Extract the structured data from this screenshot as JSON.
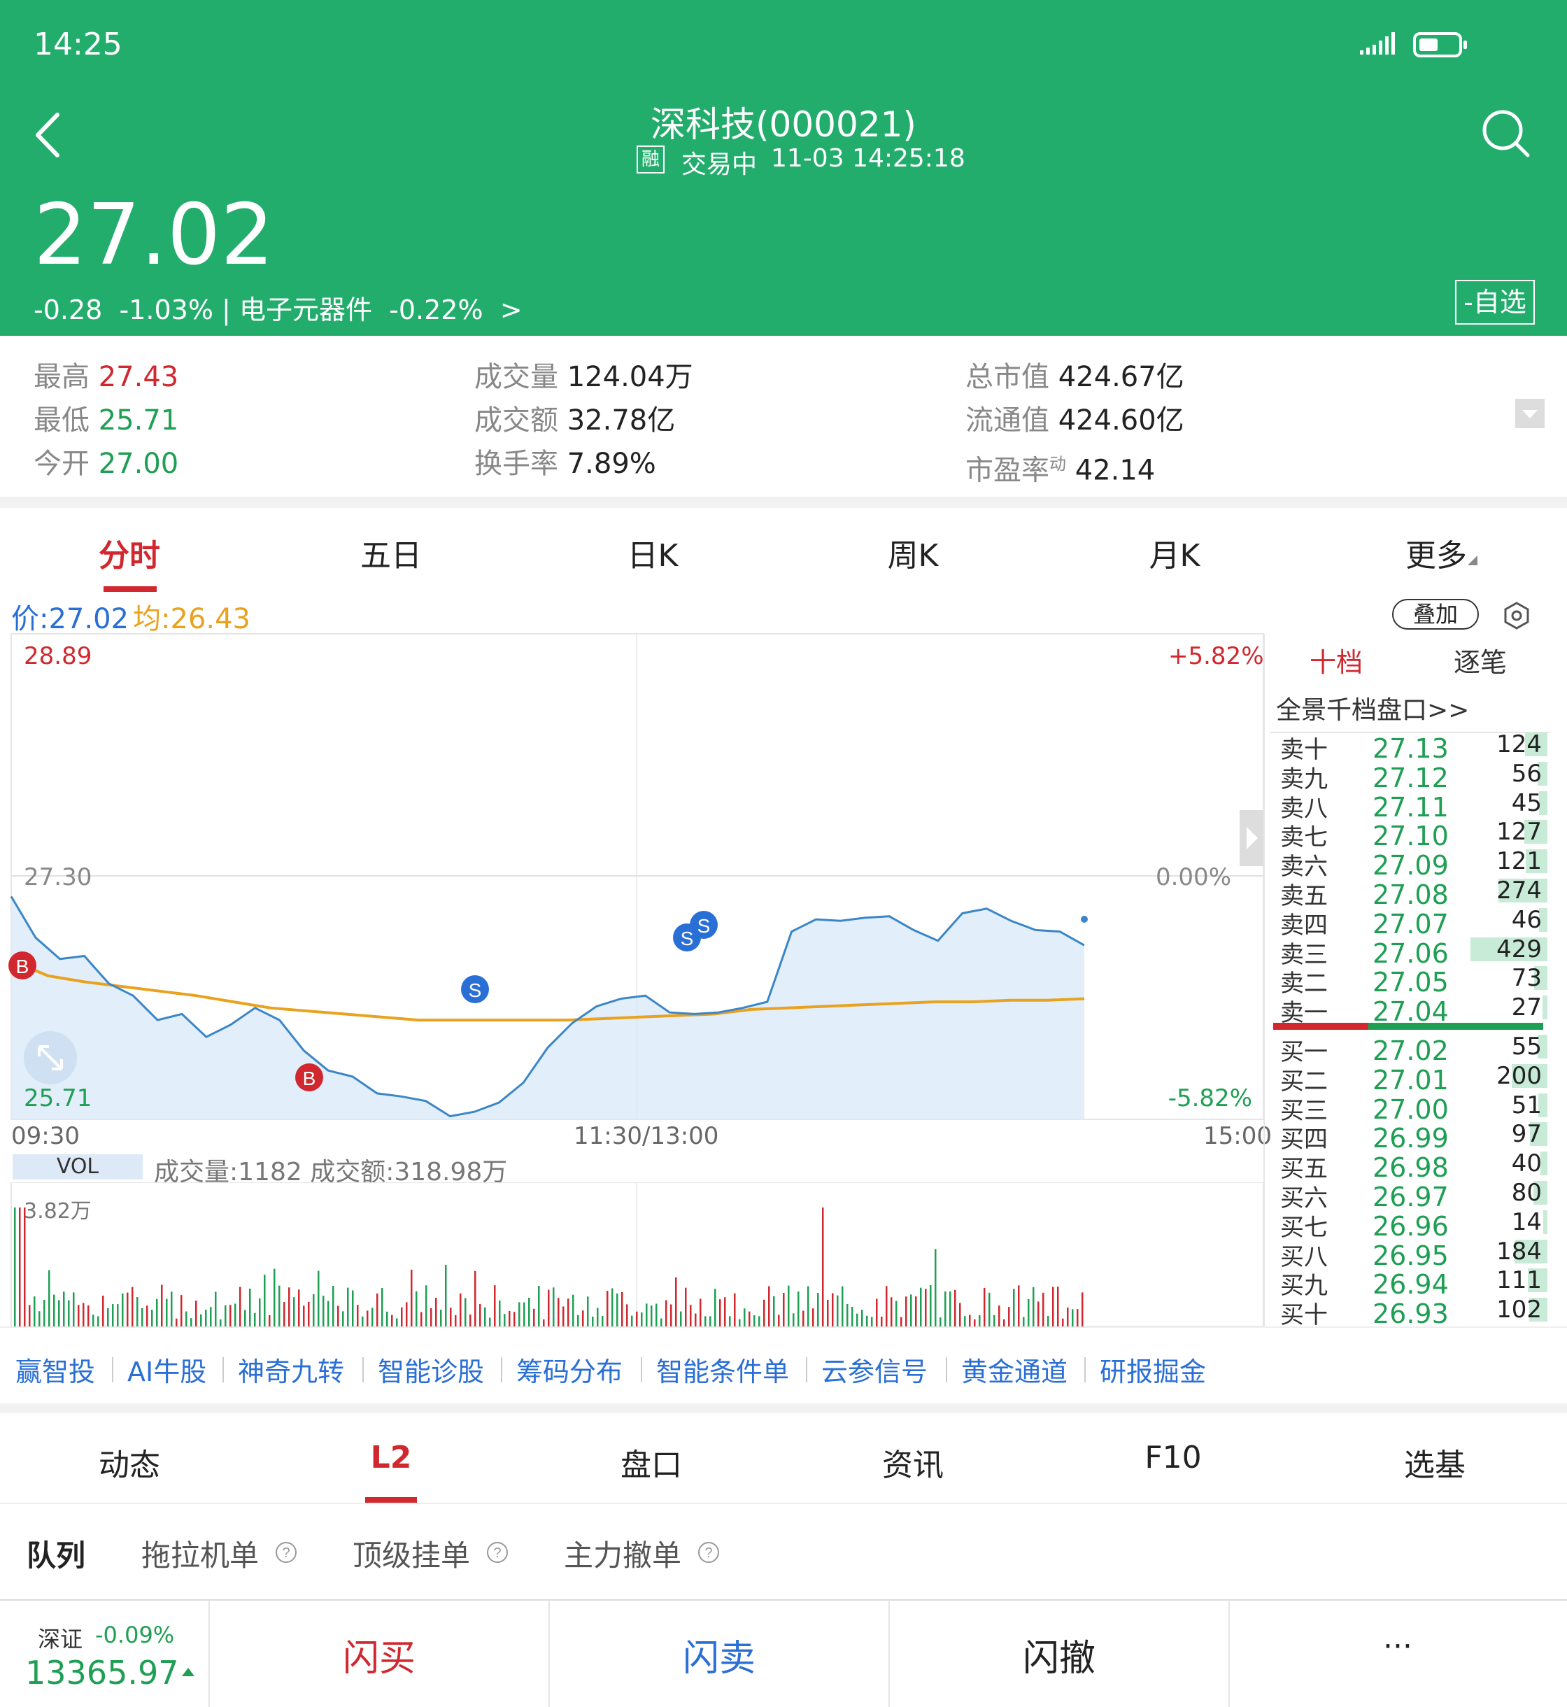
{
  "status_bar": {
    "time": "14:25"
  },
  "header": {
    "title": "深科技(000021)",
    "margin_tag": "融",
    "trade_status": "交易中",
    "datetime": "11-03 14:25:18",
    "price": "27.02",
    "change": "-0.28",
    "change_pct": "-1.03%",
    "sector_sep": "|",
    "sector": "电子元器件",
    "sector_pct": "-0.22%",
    "sector_arrow": ">",
    "watch_button": "-自选"
  },
  "stats": {
    "high_label": "最高",
    "high": "27.43",
    "low_label": "最低",
    "low": "25.71",
    "open_label": "今开",
    "open": "27.00",
    "volume_label": "成交量",
    "volume": "124.04万",
    "amount_label": "成交额",
    "amount": "32.78亿",
    "turnover_label": "换手率",
    "turnover": "7.89%",
    "mktcap_label": "总市值",
    "mktcap": "424.67亿",
    "float_label": "流通值",
    "float": "424.60亿",
    "pe_label": "市盈率",
    "pe_sup": "动",
    "pe": "42.14"
  },
  "chart_tabs": [
    "分时",
    "五日",
    "日K",
    "周K",
    "月K",
    "更多"
  ],
  "chart_header": {
    "price_label": "价:27.02",
    "avg_label": "均:26.43",
    "overlay": "叠加"
  },
  "chart_labels": {
    "ymax": "28.89",
    "ymid": "27.30",
    "ymin": "25.71",
    "pmax": "+5.82%",
    "pmid": "0.00%",
    "pmin": "-5.82%",
    "t_start": "09:30",
    "t_mid": "11:30/13:00",
    "t_end": "15:00",
    "vol_tab": "VOL",
    "vol_info": "成交量:1182 成交额:318.98万",
    "vol_max": "3.82万"
  },
  "chart_data": {
    "type": "line",
    "ylim": [
      25.71,
      28.89
    ],
    "series": [
      {
        "values": [
          27.17,
          26.9,
          26.76,
          26.78,
          26.6,
          26.52,
          26.36,
          26.4,
          26.25,
          26.33,
          26.44,
          26.36,
          26.16,
          26.03,
          25.99,
          25.88,
          25.86,
          25.83,
          25.73,
          25.76,
          25.82,
          25.95,
          26.18,
          26.34,
          26.45,
          26.5,
          26.52,
          26.41,
          26.4,
          26.41,
          26.44,
          26.48,
          26.94,
          27.02,
          27.01,
          27.03,
          27.04,
          26.95,
          26.88,
          27.06,
          27.09,
          27.01,
          26.95,
          26.94,
          26.85
        ]
      },
      {
        "values": [
          26.75,
          26.65,
          26.61,
          26.58,
          26.55,
          26.52,
          26.48,
          26.44,
          26.42,
          26.4,
          26.38,
          26.36,
          26.36,
          26.36,
          26.36,
          26.36,
          26.37,
          26.38,
          26.39,
          26.4,
          26.43,
          26.44,
          26.45,
          26.46,
          26.47,
          26.48,
          26.48,
          26.49,
          26.49,
          26.5
        ]
      }
    ]
  },
  "orderbook": {
    "tab_active": "十档",
    "tab_other": "逐笔",
    "link": "全景千档盘口>>",
    "asks": [
      {
        "label": "卖十",
        "price": "27.13",
        "vol": "124"
      },
      {
        "label": "卖九",
        "price": "27.12",
        "vol": "56"
      },
      {
        "label": "卖八",
        "price": "27.11",
        "vol": "45"
      },
      {
        "label": "卖七",
        "price": "27.10",
        "vol": "127"
      },
      {
        "label": "卖六",
        "price": "27.09",
        "vol": "121"
      },
      {
        "label": "卖五",
        "price": "27.08",
        "vol": "274"
      },
      {
        "label": "卖四",
        "price": "27.07",
        "vol": "46"
      },
      {
        "label": "卖三",
        "price": "27.06",
        "vol": "429"
      },
      {
        "label": "卖二",
        "price": "27.05",
        "vol": "73"
      },
      {
        "label": "卖一",
        "price": "27.04",
        "vol": "27"
      }
    ],
    "bids": [
      {
        "label": "买一",
        "price": "27.02",
        "vol": "55"
      },
      {
        "label": "买二",
        "price": "27.01",
        "vol": "200"
      },
      {
        "label": "买三",
        "price": "27.00",
        "vol": "51"
      },
      {
        "label": "买四",
        "price": "26.99",
        "vol": "97"
      },
      {
        "label": "买五",
        "price": "26.98",
        "vol": "40"
      },
      {
        "label": "买六",
        "price": "26.97",
        "vol": "80"
      },
      {
        "label": "买七",
        "price": "26.96",
        "vol": "14"
      },
      {
        "label": "买八",
        "price": "26.95",
        "vol": "184"
      },
      {
        "label": "买九",
        "price": "26.94",
        "vol": "111"
      },
      {
        "label": "买十",
        "price": "26.93",
        "vol": "102"
      }
    ]
  },
  "tools": [
    "赢智投",
    "AI牛股",
    "神奇九转",
    "智能诊股",
    "筹码分布",
    "智能条件单",
    "云参信号",
    "黄金通道",
    "研报掘金"
  ],
  "bottom_tabs": [
    "动态",
    "L2",
    "盘口",
    "资讯",
    "F10",
    "选基"
  ],
  "sub_tabs": [
    "队列",
    "拖拉机单",
    "顶级挂单",
    "主力撤单"
  ],
  "footer": {
    "index_name": "深证",
    "index_pct": "-0.09%",
    "index_value": "13365.97",
    "buy": "闪买",
    "sell": "闪卖",
    "cancel": "闪撤",
    "more": "···"
  },
  "colors": {
    "header_bg": "#23ad6d",
    "up": "#d0282e",
    "down": "#1f9f54",
    "avg_line": "#e9a21e",
    "price_line": "#3a86c8"
  }
}
